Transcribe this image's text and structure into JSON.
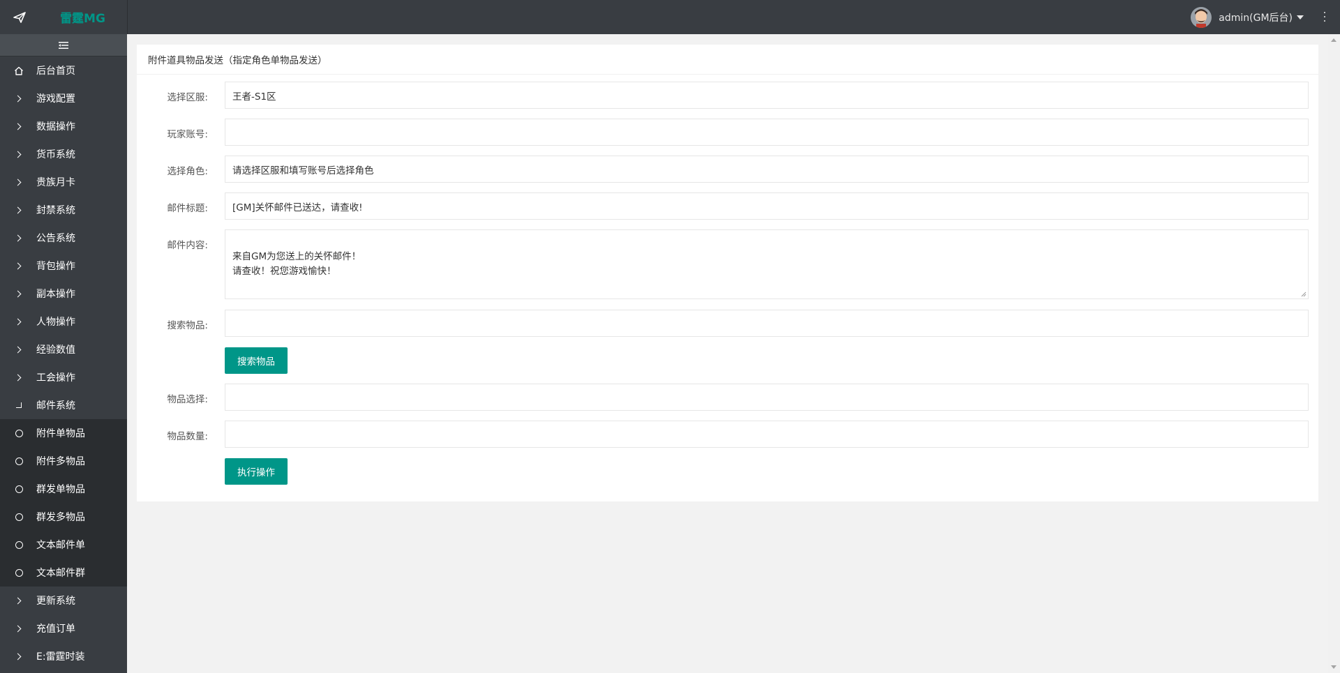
{
  "header": {
    "logo_text": "雷霆MG",
    "user_name": "admin(GM后台)"
  },
  "sidebar": {
    "items": [
      {
        "label": "后台首页",
        "icon": "home-icon",
        "sub": false
      },
      {
        "label": "游戏配置",
        "icon": "chevron-right-icon",
        "sub": false
      },
      {
        "label": "数据操作",
        "icon": "chevron-right-icon",
        "sub": false
      },
      {
        "label": "货币系统",
        "icon": "chevron-right-icon",
        "sub": false
      },
      {
        "label": "贵族月卡",
        "icon": "chevron-right-icon",
        "sub": false
      },
      {
        "label": "封禁系统",
        "icon": "chevron-right-icon",
        "sub": false
      },
      {
        "label": "公告系统",
        "icon": "chevron-right-icon",
        "sub": false
      },
      {
        "label": "背包操作",
        "icon": "chevron-right-icon",
        "sub": false
      },
      {
        "label": "副本操作",
        "icon": "chevron-right-icon",
        "sub": false
      },
      {
        "label": "人物操作",
        "icon": "chevron-right-icon",
        "sub": false
      },
      {
        "label": "经验数值",
        "icon": "chevron-right-icon",
        "sub": false
      },
      {
        "label": "工会操作",
        "icon": "chevron-right-icon",
        "sub": false
      },
      {
        "label": "邮件系统",
        "icon": "expanded-corner-icon",
        "sub": false
      },
      {
        "label": "附件单物品",
        "icon": "circle-icon",
        "sub": true
      },
      {
        "label": "附件多物品",
        "icon": "circle-icon",
        "sub": true
      },
      {
        "label": "群发单物品",
        "icon": "circle-icon",
        "sub": true
      },
      {
        "label": "群发多物品",
        "icon": "circle-icon",
        "sub": true
      },
      {
        "label": "文本邮件单",
        "icon": "circle-icon",
        "sub": true
      },
      {
        "label": "文本邮件群",
        "icon": "circle-icon",
        "sub": true
      },
      {
        "label": "更新系统",
        "icon": "chevron-right-icon",
        "sub": false
      },
      {
        "label": "充值订单",
        "icon": "chevron-right-icon",
        "sub": false
      },
      {
        "label": "E:雷霆时装",
        "icon": "chevron-right-icon",
        "sub": false
      }
    ]
  },
  "card": {
    "title": "附件道具物品发送（指定角色单物品发送）"
  },
  "form": {
    "server_label": "选择区服:",
    "server_value": "王者-S1区",
    "account_label": "玩家账号:",
    "account_value": "",
    "role_label": "选择角色:",
    "role_value": "请选择区服和填写账号后选择角色",
    "mail_title_label": "邮件标题:",
    "mail_title_value": "[GM]关怀邮件已送达，请查收!",
    "mail_content_label": "邮件内容:",
    "mail_content_value": "来自GM为您送上的关怀邮件！\n请查收！祝您游戏愉快！",
    "search_item_label": "搜索物品:",
    "search_item_value": "",
    "search_button": "搜索物品",
    "item_select_label": "物品选择:",
    "item_select_value": "",
    "item_qty_label": "物品数量:",
    "item_qty_value": "",
    "execute_button": "执行操作"
  },
  "colors": {
    "header_bg": "#393d42",
    "accent": "#009688",
    "submenu_bg": "#2a2d30"
  }
}
